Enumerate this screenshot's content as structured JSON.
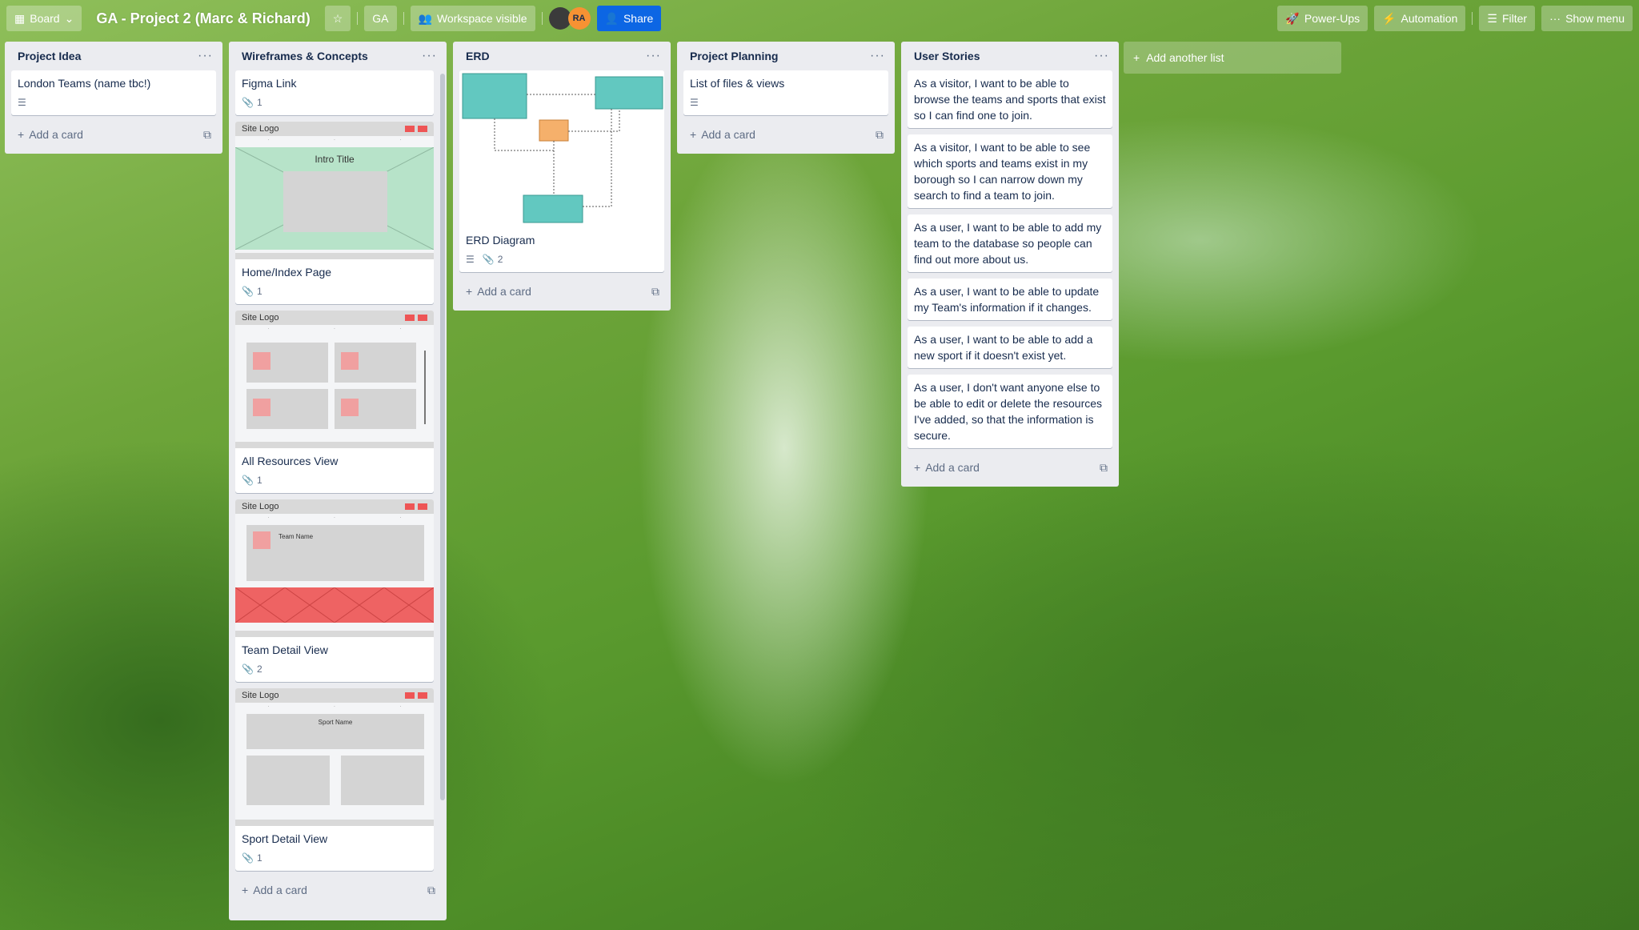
{
  "topbar": {
    "view_label": "Board",
    "board_title": "GA - Project 2 (Marc & Richard)",
    "workspace_short": "GA",
    "visibility_label": "Workspace visible",
    "avatar2_initials": "RA",
    "share_label": "Share",
    "powerups_label": "Power-Ups",
    "automation_label": "Automation",
    "filter_label": "Filter",
    "show_menu_label": "Show menu"
  },
  "add_card_label": "Add a card",
  "add_list_label": "Add another list",
  "lists": [
    {
      "title": "Project Idea",
      "cards": [
        {
          "title": "London Teams (name tbc!)",
          "has_description": true
        }
      ]
    },
    {
      "title": "Wireframes & Concepts",
      "cards": [
        {
          "title": "Figma Link",
          "attachments": "1"
        },
        {
          "title": "Home/Index Page",
          "attachments": "1",
          "cover": {
            "logo": "Site Logo",
            "intro": "Intro Title"
          }
        },
        {
          "title": "All Resources View",
          "attachments": "1",
          "cover": {
            "logo": "Site Logo"
          }
        },
        {
          "title": "Team Detail View",
          "attachments": "2",
          "cover": {
            "logo": "Site Logo",
            "team": "Team Name"
          }
        },
        {
          "title": "Sport Detail View",
          "attachments": "1",
          "cover": {
            "logo": "Site Logo",
            "sport": "Sport Name"
          }
        }
      ]
    },
    {
      "title": "ERD",
      "cards": [
        {
          "title": "ERD Diagram",
          "has_description": true,
          "attachments": "2"
        }
      ]
    },
    {
      "title": "Project Planning",
      "cards": [
        {
          "title": "List of files & views",
          "has_description": true
        }
      ]
    },
    {
      "title": "User Stories",
      "cards": [
        {
          "title": "As a visitor, I want to be able to browse the teams and sports that exist so I can find one to join."
        },
        {
          "title": "As a visitor, I want to be able to see which sports and teams exist in my borough so I can narrow down my search to find a team to join."
        },
        {
          "title": "As a user, I want to be able to add my team to the database so people can find out more about us."
        },
        {
          "title": "As a user, I want to be able to update my Team's information if it changes."
        },
        {
          "title": "As a user, I want to be able to add a new sport if it doesn't exist yet."
        },
        {
          "title": "As a user, I don't want anyone else to be able to edit or delete the resources I've added, so that the information is secure."
        }
      ]
    }
  ]
}
